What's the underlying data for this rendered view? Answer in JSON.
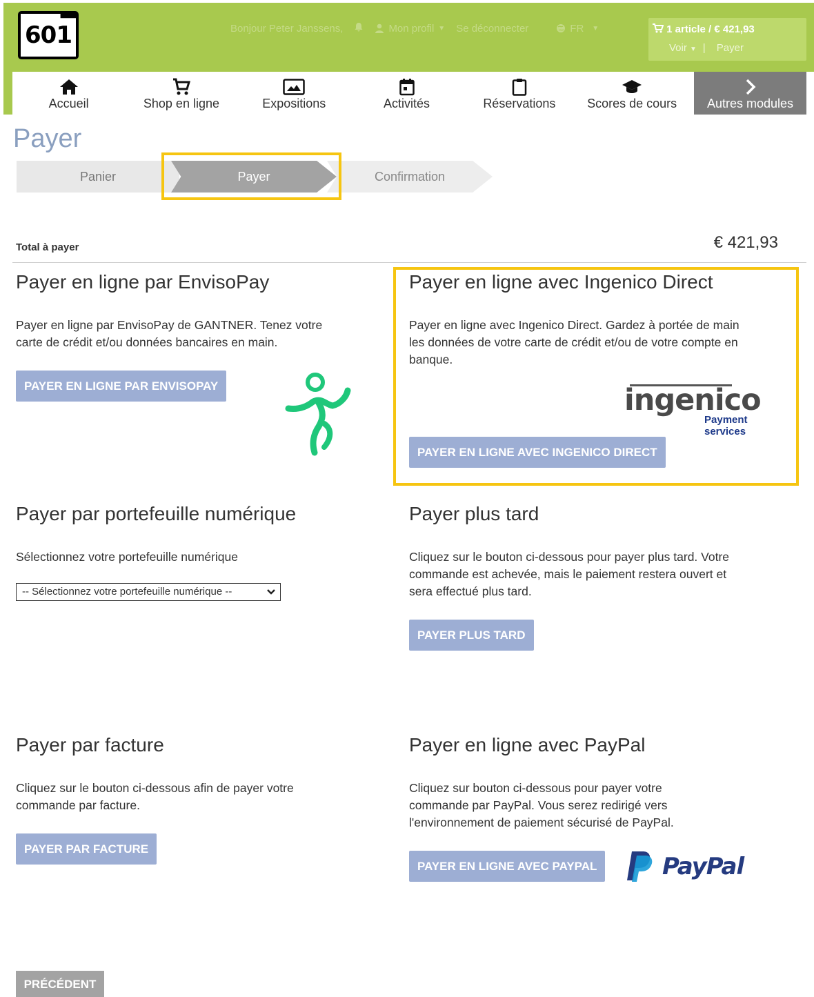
{
  "header": {
    "logo_text": "601",
    "greeting": "Bonjour Peter Janssens,",
    "profile_label": "Mon profil",
    "logout_label": "Se déconnecter",
    "language": "FR",
    "cart_summary": "1 article / € 421,93",
    "cart_view": "Voir",
    "cart_separator": "|",
    "cart_pay": "Payer",
    "brand_color": "#a8c94e"
  },
  "nav": {
    "items": [
      {
        "label": "Accueil",
        "icon": "home-icon"
      },
      {
        "label": "Shop en ligne",
        "icon": "cart-icon"
      },
      {
        "label": "Expositions",
        "icon": "image-icon"
      },
      {
        "label": "Activités",
        "icon": "calendar-icon"
      },
      {
        "label": "Réservations",
        "icon": "clipboard-icon"
      },
      {
        "label": "Scores de cours",
        "icon": "graduation-cap-icon"
      }
    ],
    "more_label": "Autres modules"
  },
  "page": {
    "title": "Payer",
    "steps": [
      "Panier",
      "Payer",
      "Confirmation"
    ],
    "active_step": "Payer",
    "total_label": "Total à payer",
    "total_value": "€ 421,93"
  },
  "sections": {
    "envisopay": {
      "title": "Payer en ligne par EnvisoPay",
      "text": "Payer en ligne par EnvisoPay de GANTNER. Tenez votre carte de crédit et/ou données bancaires en main.",
      "button": "PAYER EN LIGNE PAR ENVISOPAY"
    },
    "ingenico": {
      "title": "Payer en ligne avec Ingenico Direct",
      "text": "Payer en ligne avec Ingenico Direct. Gardez à portée de main les données de votre carte de crédit et/ou de votre compte en banque.",
      "button": "PAYER EN LIGNE AVEC INGENICO DIRECT",
      "logo_text": "ingenico",
      "logo_sub1": "Payment",
      "logo_sub2": "services"
    },
    "wallet": {
      "title": "Payer par portefeuille numérique",
      "text": "Sélectionnez votre portefeuille numérique",
      "select_value": "-- Sélectionnez votre portefeuille numérique --"
    },
    "later": {
      "title": "Payer plus tard",
      "text": "Cliquez sur le bouton ci-dessous pour payer plus tard. Votre commande est achevée, mais le paiement restera ouvert et sera effectué plus tard.",
      "button": "PAYER PLUS TARD"
    },
    "invoice": {
      "title": "Payer par facture",
      "text": "Cliquez sur le bouton ci-dessous afin de payer votre commande par facture.",
      "button": "PAYER PAR FACTURE"
    },
    "paypal": {
      "title": "Payer en ligne avec PayPal",
      "text": "Cliquez sur bouton ci-dessous pour payer votre commande par PayPal. Vous serez redirigé vers l'environnement de paiement sécurisé de PayPal.",
      "button": "PAYER EN LIGNE AVEC PAYPAL",
      "logo_text": "PayPal"
    }
  },
  "footer": {
    "previous_button": "PRÉCÉDENT"
  }
}
